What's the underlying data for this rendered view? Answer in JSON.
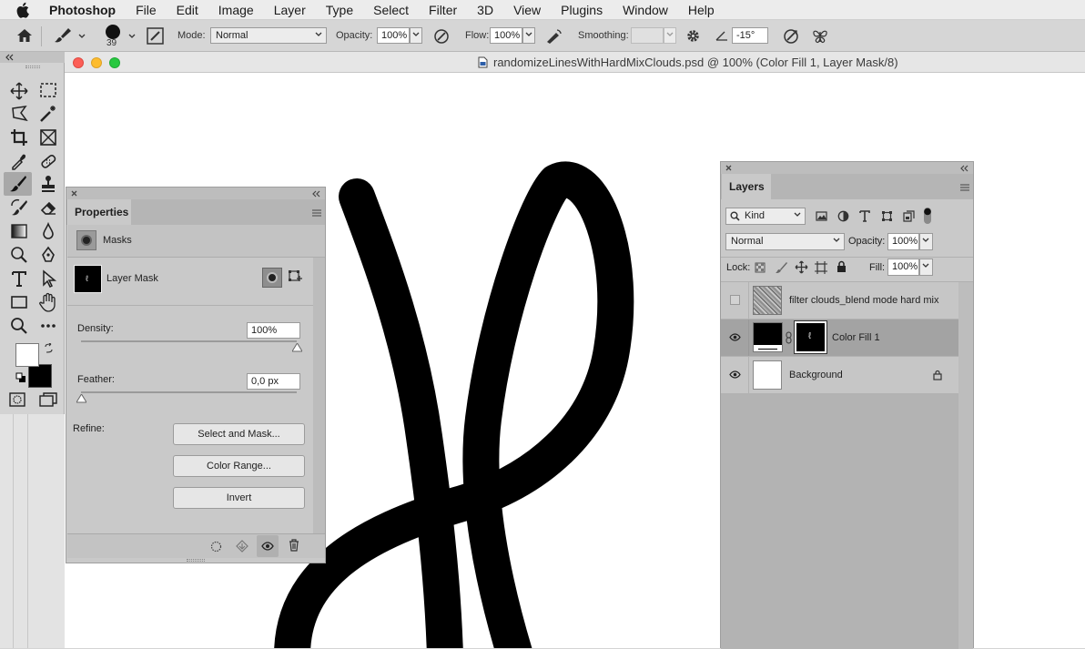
{
  "menubar": {
    "app_name": "Photoshop",
    "items": [
      "File",
      "Edit",
      "Image",
      "Layer",
      "Type",
      "Select",
      "Filter",
      "3D",
      "View",
      "Plugins",
      "Window",
      "Help"
    ]
  },
  "options_bar": {
    "brush_size": "39",
    "mode_label": "Mode:",
    "mode_value": "Normal",
    "opacity_label": "Opacity:",
    "opacity_value": "100%",
    "flow_label": "Flow:",
    "flow_value": "100%",
    "smoothing_label": "Smoothing:",
    "smoothing_value": "",
    "angle_value": "-15°"
  },
  "document": {
    "title": "randomizeLinesWithHardMixClouds.psd @ 100% (Color Fill 1, Layer Mask/8)"
  },
  "properties_panel": {
    "tab": "Properties",
    "section": "Masks",
    "mask_name": "Layer Mask",
    "density_label": "Density:",
    "density_value": "100%",
    "density_fraction": 1.0,
    "feather_label": "Feather:",
    "feather_value": "0,0 px",
    "feather_fraction": 0.0,
    "refine_label": "Refine:",
    "buttons": {
      "select_and_mask": "Select and Mask...",
      "color_range": "Color Range...",
      "invert": "Invert"
    }
  },
  "layers_panel": {
    "tab": "Layers",
    "filter_kind": "Kind",
    "blend_mode": "Normal",
    "opacity_label": "Opacity:",
    "opacity_value": "100%",
    "lock_label": "Lock:",
    "fill_label": "Fill:",
    "fill_value": "100%",
    "layers": [
      {
        "name": "filter clouds_blend mode hard mix",
        "visible": false,
        "selected": false
      },
      {
        "name": "Color Fill 1",
        "visible": true,
        "selected": true
      },
      {
        "name": "Background",
        "visible": true,
        "selected": false,
        "locked": true
      }
    ]
  },
  "colors": {
    "foreground": "#ffffff",
    "background": "#000000",
    "accent_selected_row": "#a3a3a3"
  }
}
